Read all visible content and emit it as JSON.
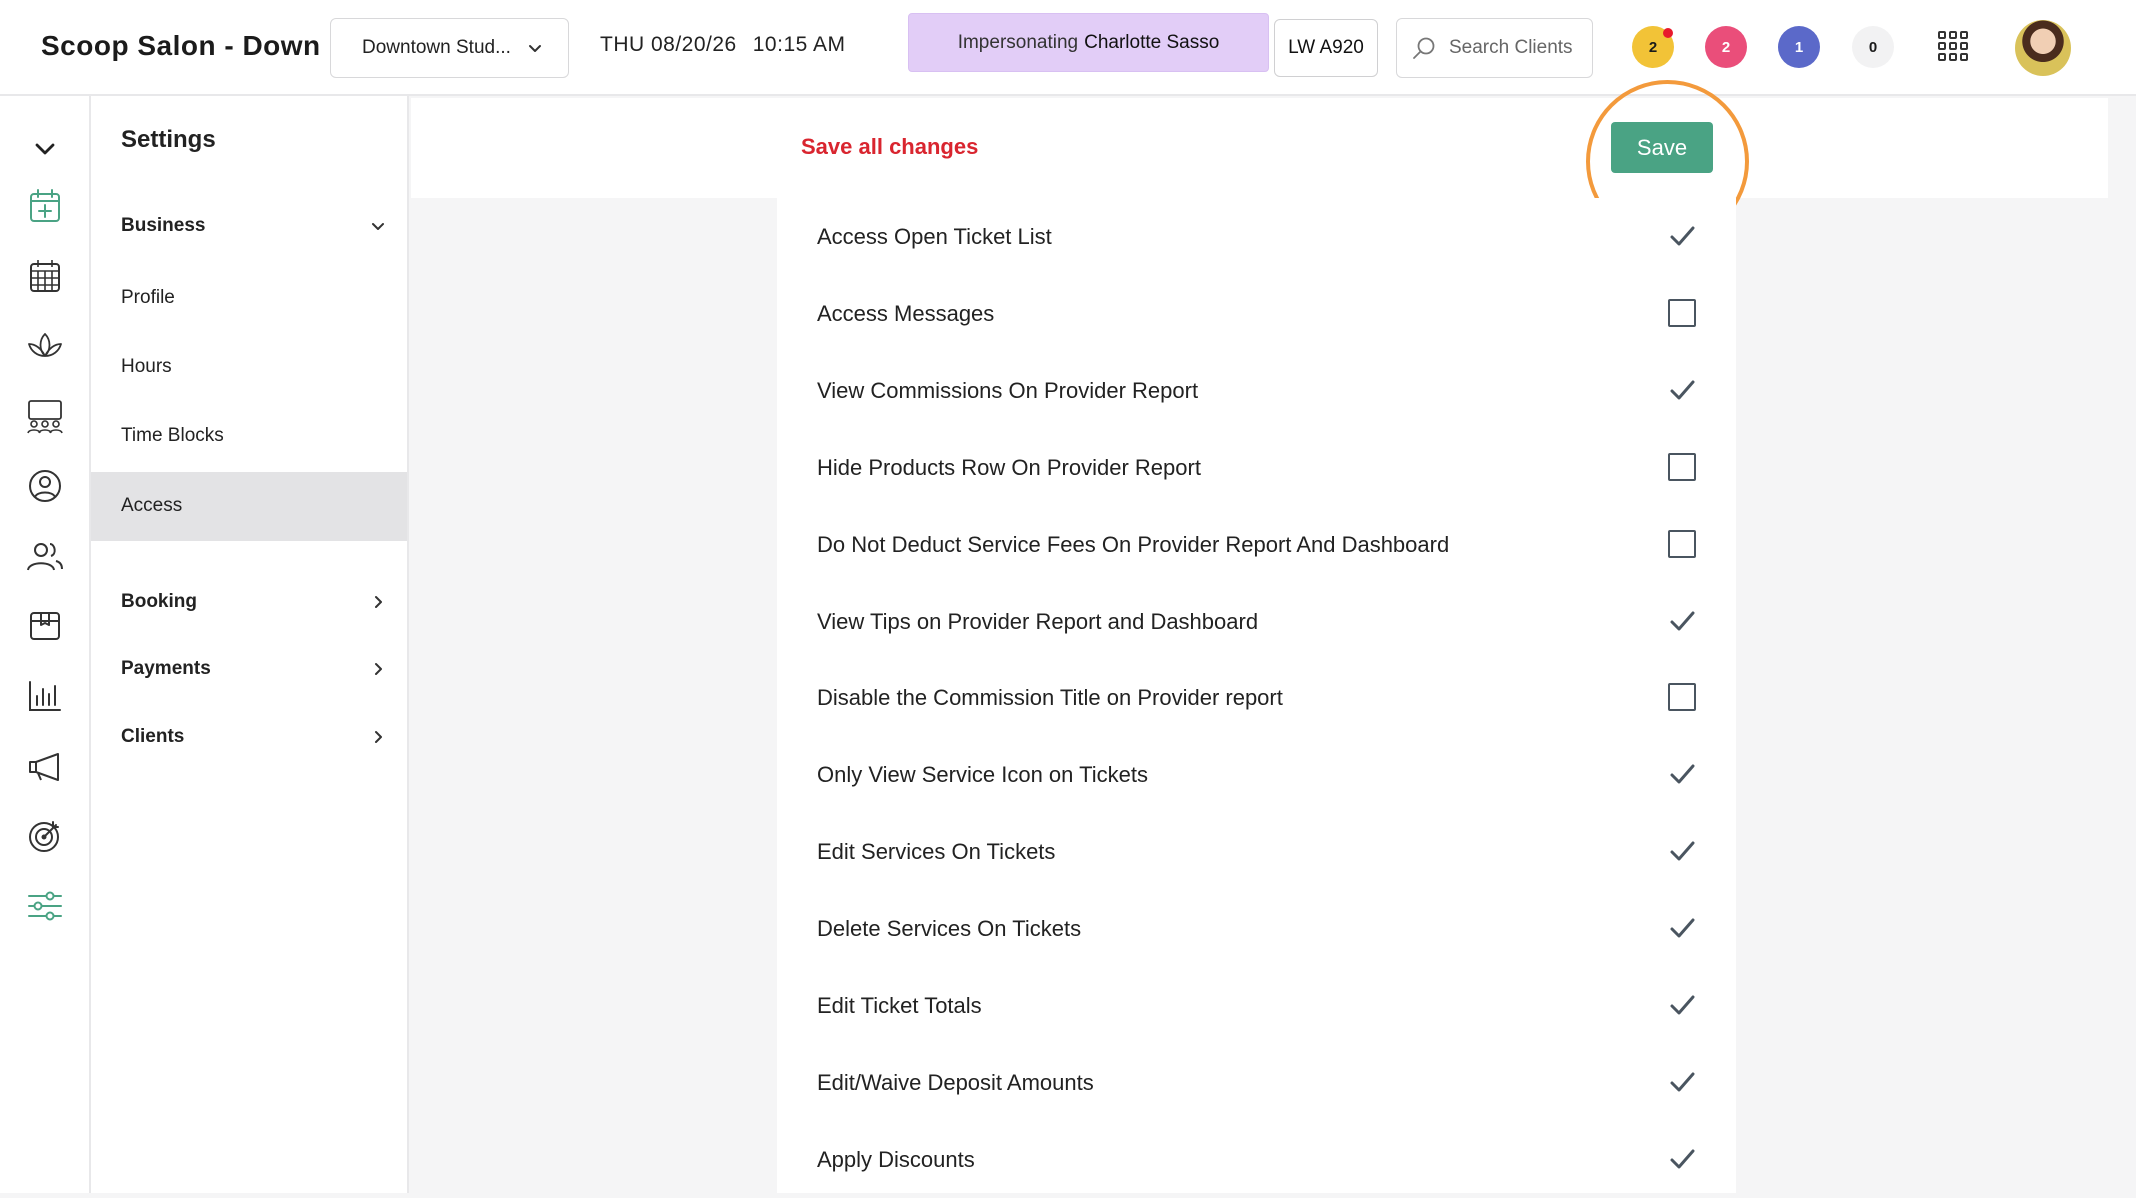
{
  "header": {
    "brand": "Scoop Salon - Down",
    "location": "Downtown Stud...",
    "date": "THU 08/20/26",
    "time": "10:15 AM",
    "impersonating_label": "Impersonating",
    "impersonating_name": "Charlotte Sasso",
    "station": "LW A920",
    "search_placeholder": "Search Clients",
    "counters": [
      {
        "value": "2",
        "color": "#f2c337",
        "text_color": "#1b1b1b",
        "has_alert": true
      },
      {
        "value": "2",
        "color": "#ea4e7a",
        "text_color": "#ffffff",
        "has_alert": false
      },
      {
        "value": "1",
        "color": "#5b69c9",
        "text_color": "#ffffff",
        "has_alert": false
      },
      {
        "value": "0",
        "color": "#f2f2f3",
        "text_color": "#1b1b1b",
        "has_alert": false
      }
    ]
  },
  "sidebar": {
    "title": "Settings",
    "business_label": "Business",
    "business_items": [
      "Profile",
      "Hours",
      "Time Blocks",
      "Access"
    ],
    "active_item": "Access",
    "groups": [
      "Booking",
      "Payments",
      "Clients"
    ]
  },
  "actions": {
    "save_all_label": "Save all changes",
    "save_label": "Save"
  },
  "permissions": [
    {
      "label": "Access Open Ticket List",
      "checked": true
    },
    {
      "label": "Access Messages",
      "checked": false
    },
    {
      "label": "View Commissions On Provider Report",
      "checked": true
    },
    {
      "label": "Hide Products Row On Provider Report",
      "checked": false
    },
    {
      "label": "Do Not Deduct Service Fees On Provider Report And Dashboard",
      "checked": false
    },
    {
      "label": "View Tips on Provider Report and Dashboard",
      "checked": true
    },
    {
      "label": "Disable the Commission Title on Provider report",
      "checked": false
    },
    {
      "label": "Only View Service Icon on Tickets",
      "checked": true
    },
    {
      "label": "Edit Services On Tickets",
      "checked": true
    },
    {
      "label": "Delete Services On Tickets",
      "checked": true
    },
    {
      "label": "Edit Ticket Totals",
      "checked": true
    },
    {
      "label": "Edit/Waive Deposit Amounts",
      "checked": true
    },
    {
      "label": "Apply Discounts",
      "checked": true
    }
  ],
  "colors": {
    "accent_green": "#4aa384",
    "save_all_red": "#d9252f",
    "highlight_orange": "#f39a3c",
    "impersonate_bg": "#e2cdf7"
  }
}
